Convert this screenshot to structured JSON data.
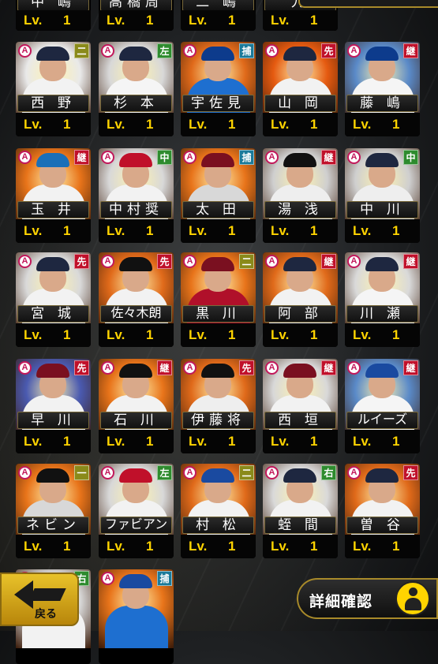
{
  "level_prefix": "Lv.",
  "level_value": "1",
  "rarity_badge": "A",
  "back_button_label": "戻る",
  "detail_button_label": "詳細確認",
  "detail_icon": "player-silhouette-icon",
  "colors": {
    "position_green": "#2e8b2e",
    "position_olive": "#8a8a1a",
    "position_teal": "#1a7a9a",
    "position_red": "#c0102a",
    "position_blue": "#1a4aa0",
    "level_text": "#ffd400",
    "rarity": "#c2185b"
  },
  "partial_top_row": [
    {
      "name": "中 嶋",
      "has_name": true
    },
    {
      "name": "高橋周",
      "has_name": true
    },
    {
      "name": "二 嶋",
      "has_name": true
    },
    {
      "name": "九",
      "has_name": true
    }
  ],
  "rows": [
    [
      {
        "name": "西 野",
        "pos": "二",
        "pos_color": "#8a8a1a",
        "bg": "#e9e9e9",
        "uni": "#f2f2f2",
        "cap": "#1e2740"
      },
      {
        "name": "杉 本",
        "pos": "左",
        "pos_color": "#2e8b2e",
        "bg": "#d8d8d8",
        "uni": "#f5f5f5",
        "cap": "#1e2740"
      },
      {
        "name": "宇佐見",
        "pos": "捕",
        "pos_color": "#1a7a9a",
        "bg": "#e06a1a",
        "uni": "#1e6fd0",
        "cap": "#0d3b8c"
      },
      {
        "name": "山 岡",
        "pos": "先",
        "pos_color": "#c0102a",
        "bg": "#e55a10",
        "uni": "#f2f2f2",
        "cap": "#1e2740"
      },
      {
        "name": "藤 嶋",
        "pos": "継",
        "pos_color": "#c0102a",
        "bg": "#5a8ac8",
        "uni": "#f5f5f5",
        "cap": "#0d3b8c"
      }
    ],
    [
      {
        "name": "玉 井",
        "pos": "継",
        "pos_color": "#c0102a",
        "bg": "#e8741a",
        "uni": "#f2f2f2",
        "cap": "#1a6fb8"
      },
      {
        "name": "中村奨",
        "pos": "中",
        "pos_color": "#2e8b2e",
        "bg": "#d8d8d8",
        "uni": "#f2f2f2",
        "cap": "#c0102a"
      },
      {
        "name": "太 田",
        "pos": "捕",
        "pos_color": "#1a7a9a",
        "bg": "#e8741a",
        "uni": "#d8d8d8",
        "cap": "#7a1020"
      },
      {
        "name": "湯 浅",
        "pos": "継",
        "pos_color": "#c0102a",
        "bg": "#cfcfcf",
        "uni": "#eeeeee",
        "cap": "#111111"
      },
      {
        "name": "中 川",
        "pos": "中",
        "pos_color": "#2e8b2e",
        "bg": "#cfcfcf",
        "uni": "#eeeeee",
        "cap": "#1e2740"
      }
    ],
    [
      {
        "name": "宮 城",
        "pos": "先",
        "pos_color": "#c0102a",
        "bg": "#d9d9d9",
        "uni": "#f2f2f2",
        "cap": "#1e2740"
      },
      {
        "name": "佐々木朗",
        "pos": "先",
        "pos_color": "#c0102a",
        "bg": "#e06a1a",
        "uni": "#f2f2f2",
        "cap": "#111111"
      },
      {
        "name": "黒 川",
        "pos": "二",
        "pos_color": "#8a8a1a",
        "bg": "#e8741a",
        "uni": "#b0102a",
        "cap": "#7a1020"
      },
      {
        "name": "阿 部",
        "pos": "継",
        "pos_color": "#c0102a",
        "bg": "#e06a1a",
        "uni": "#f2f2f2",
        "cap": "#1e2740"
      },
      {
        "name": "川 瀬",
        "pos": "継",
        "pos_color": "#c0102a",
        "bg": "#d9d9d9",
        "uni": "#f5f5f5",
        "cap": "#1e2740"
      }
    ],
    [
      {
        "name": "早 川",
        "pos": "先",
        "pos_color": "#c0102a",
        "bg": "#4a5ab0",
        "uni": "#f2f2f2",
        "cap": "#7a1020"
      },
      {
        "name": "石 川",
        "pos": "継",
        "pos_color": "#c0102a",
        "bg": "#e8741a",
        "uni": "#f2f2f2",
        "cap": "#111111"
      },
      {
        "name": "伊藤将",
        "pos": "先",
        "pos_color": "#c0102a",
        "bg": "#e06a1a",
        "uni": "#eeeeee",
        "cap": "#111111"
      },
      {
        "name": "西 垣",
        "pos": "継",
        "pos_color": "#c0102a",
        "bg": "#d8d8d8",
        "uni": "#f2f2f2",
        "cap": "#7a1020"
      },
      {
        "name": "ルイーズ",
        "pos": "継",
        "pos_color": "#c0102a",
        "bg": "#5a8ac8",
        "uni": "#f5f5f5",
        "cap": "#1a4aa0"
      }
    ],
    [
      {
        "name": "ネビン",
        "pos": "一",
        "pos_color": "#8a8a1a",
        "bg": "#e8741a",
        "uni": "#d8d8d8",
        "cap": "#111111"
      },
      {
        "name": "ファビアン",
        "pos": "左",
        "pos_color": "#2e8b2e",
        "bg": "#d8d8d8",
        "uni": "#f2f2f2",
        "cap": "#c0102a"
      },
      {
        "name": "村 松",
        "pos": "二",
        "pos_color": "#8a8a1a",
        "bg": "#e06a1a",
        "uni": "#f2f2f2",
        "cap": "#1a4aa0"
      },
      {
        "name": "蛭 間",
        "pos": "右",
        "pos_color": "#2e8b2e",
        "bg": "#d9d9d9",
        "uni": "#f2f2f2",
        "cap": "#1e2740"
      },
      {
        "name": "曽 谷",
        "pos": "先",
        "pos_color": "#c0102a",
        "bg": "#e06a1a",
        "uni": "#f2f2f2",
        "cap": "#1e2740"
      }
    ],
    [
      {
        "name": "",
        "pos": "右",
        "pos_color": "#2e8b2e",
        "bg": "#d8d8d8",
        "uni": "#f2f2f2",
        "cap": "#111111"
      },
      {
        "name": "",
        "pos": "捕",
        "pos_color": "#1a7a9a",
        "bg": "#e8741a",
        "uni": "#1e6fd0",
        "cap": "#1a4aa0"
      }
    ]
  ]
}
